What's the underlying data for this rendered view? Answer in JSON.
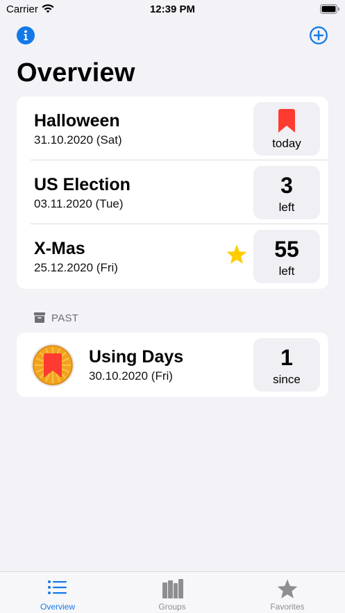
{
  "status_bar": {
    "carrier": "Carrier",
    "time": "12:39 PM"
  },
  "nav": {
    "title": "Overview",
    "info_icon": "info-icon",
    "add_icon": "plus-circle-icon"
  },
  "events": [
    {
      "name": "Halloween",
      "date": "31.10.2020 (Sat)",
      "count": "",
      "unit": "today",
      "badge": "bookmark-icon",
      "favorite": false
    },
    {
      "name": "US Election",
      "date": "03.11.2020 (Tue)",
      "count": "3",
      "unit": "left",
      "favorite": false
    },
    {
      "name": "X-Mas",
      "date": "25.12.2020 (Fri)",
      "count": "55",
      "unit": "left",
      "favorite": true
    }
  ],
  "past_section": {
    "label": "PAST",
    "icon": "archive-icon",
    "events": [
      {
        "name": "Using Days",
        "date": "30.10.2020 (Fri)",
        "count": "1",
        "unit": "since",
        "icon": "app-badge-icon"
      }
    ]
  },
  "tab_bar": {
    "tabs": [
      {
        "label": "Overview",
        "icon": "list-icon",
        "selected": true
      },
      {
        "label": "Groups",
        "icon": "books-icon",
        "selected": false
      },
      {
        "label": "Favorites",
        "icon": "star-icon",
        "selected": false
      }
    ]
  },
  "colors": {
    "accent": "#1479e8",
    "bookmark_red": "#fe3b30",
    "star_yellow": "#ffcc00",
    "background": "#f2f2f7"
  }
}
